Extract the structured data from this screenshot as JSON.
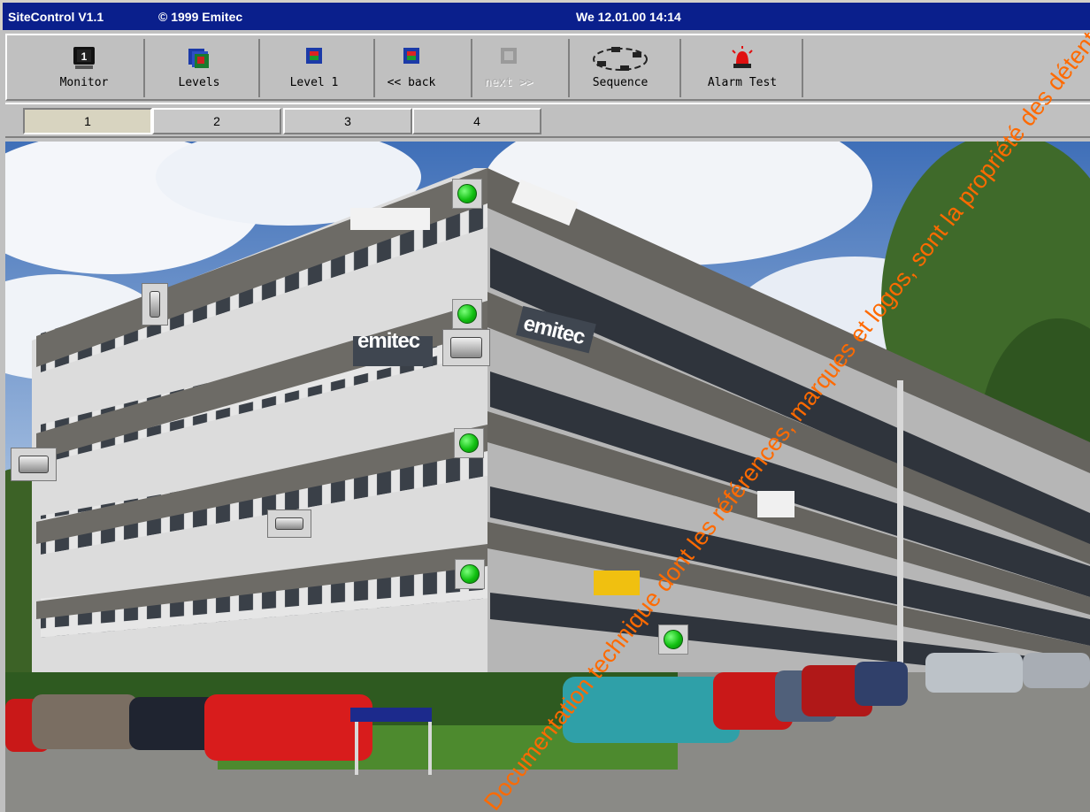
{
  "window": {
    "app_title": "SiteControl V1.1",
    "copyright": "© 1999 Emitec",
    "datetime": "We 12.01.00  14:14",
    "title_bar_color": "#0a1f8c"
  },
  "toolbar": {
    "buttons": [
      {
        "label": "Monitor",
        "icon": "monitor-icon",
        "enabled": true
      },
      {
        "label": "Levels",
        "icon": "levels-icon",
        "enabled": true
      },
      {
        "label": "Level 1",
        "icon": "level-icon",
        "enabled": true
      },
      {
        "label": "<< back",
        "icon": "back-icon",
        "enabled": true
      },
      {
        "label": "next >>",
        "icon": "next-icon",
        "enabled": false
      },
      {
        "label": "Sequence",
        "icon": "sequence-icon",
        "enabled": true
      },
      {
        "label": "Alarm Test",
        "icon": "alarm-siren-icon",
        "enabled": true
      }
    ]
  },
  "pages": {
    "tabs": [
      "1",
      "2",
      "3",
      "4"
    ],
    "active": "1"
  },
  "scene": {
    "building_signs": [
      "emitec",
      "emitec"
    ],
    "sensor_status_color": "#11c011",
    "sensors": [
      {
        "status": "ok"
      },
      {
        "status": "ok"
      },
      {
        "status": "ok"
      },
      {
        "status": "ok"
      },
      {
        "status": "ok"
      }
    ],
    "cameras": [
      {
        "type": "camera"
      },
      {
        "type": "camera"
      },
      {
        "type": "camera"
      },
      {
        "type": "camera"
      }
    ]
  },
  "watermark": "Documentation technique dont les références, marques et logos, sont la propriété des détenteurs"
}
